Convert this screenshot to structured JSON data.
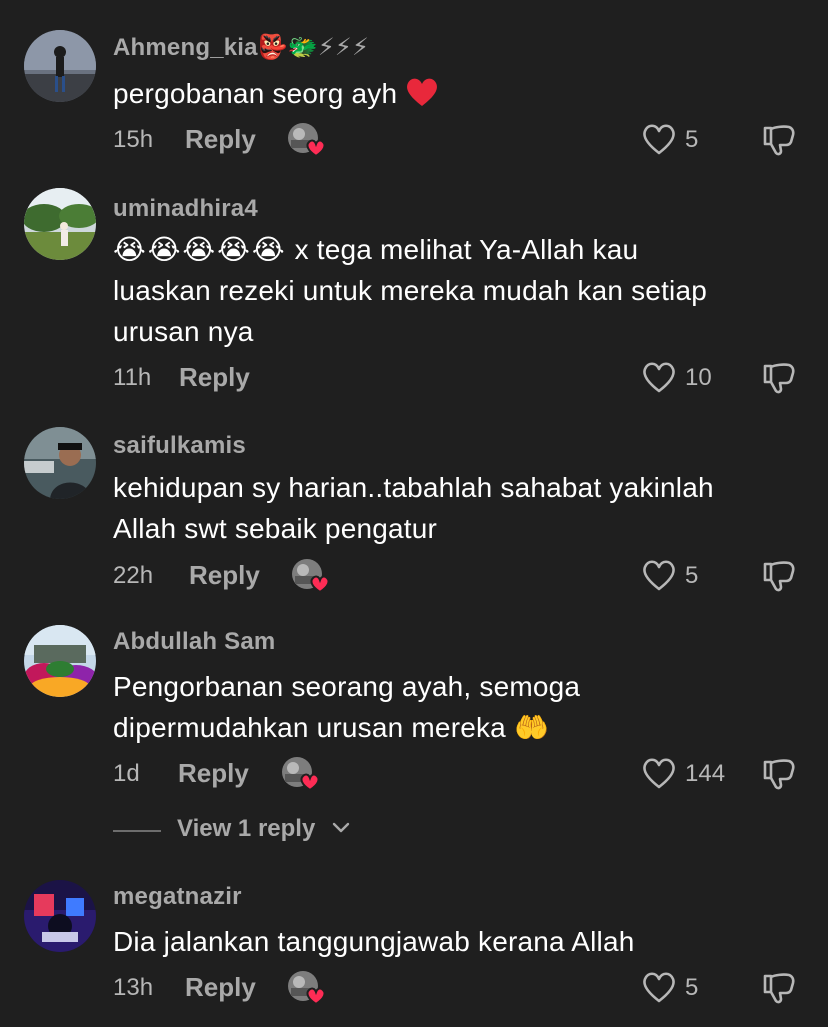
{
  "comments": [
    {
      "username": "Ahmeng_kia",
      "username_emoji": "👺🐲⚡⚡⚡",
      "text": "pergobanan seorg ayh",
      "time": "15h",
      "reply_label": "Reply",
      "likes": "5",
      "liked_by_creator": true
    },
    {
      "username": "uminadhira4",
      "emoji_prefix": "😭😭😭😭😭",
      "line1": "x tega melihat Ya-Allah kau",
      "line2": "luaskan rezeki untuk mereka mudah kan setiap",
      "line3": "urusan nya",
      "time": "11h",
      "reply_label": "Reply",
      "likes": "10",
      "liked_by_creator": false
    },
    {
      "username": "saifulkamis",
      "line1": "kehidupan sy harian..tabahlah sahabat yakinlah",
      "line2": "Allah swt sebaik pengatur",
      "time": "22h",
      "reply_label": "Reply",
      "likes": "5",
      "liked_by_creator": true
    },
    {
      "username": "Abdullah Sam",
      "line1": "Pengorbanan seorang ayah, semoga",
      "line2": "dipermudahkan urusan mereka",
      "line2_emoji": "🤲",
      "time": "1d",
      "reply_label": "Reply",
      "likes": "144",
      "liked_by_creator": true,
      "view_replies_label": "View 1 reply"
    },
    {
      "username": "megatnazir",
      "text": "Dia jalankan tanggungjawab kerana Allah",
      "time": "13h",
      "reply_label": "Reply",
      "likes": "5",
      "liked_by_creator": true
    }
  ],
  "icons": {
    "like": "heart-outline-icon",
    "dislike": "thumbs-down-icon",
    "liked_by": "creator-avatar-heart-badge",
    "view_more": "chevron-down-icon"
  },
  "colors": {
    "background": "#1f1f1f",
    "text": "#ffffff",
    "muted": "#a9a9a9",
    "heart_badge": "#fe2c55"
  }
}
